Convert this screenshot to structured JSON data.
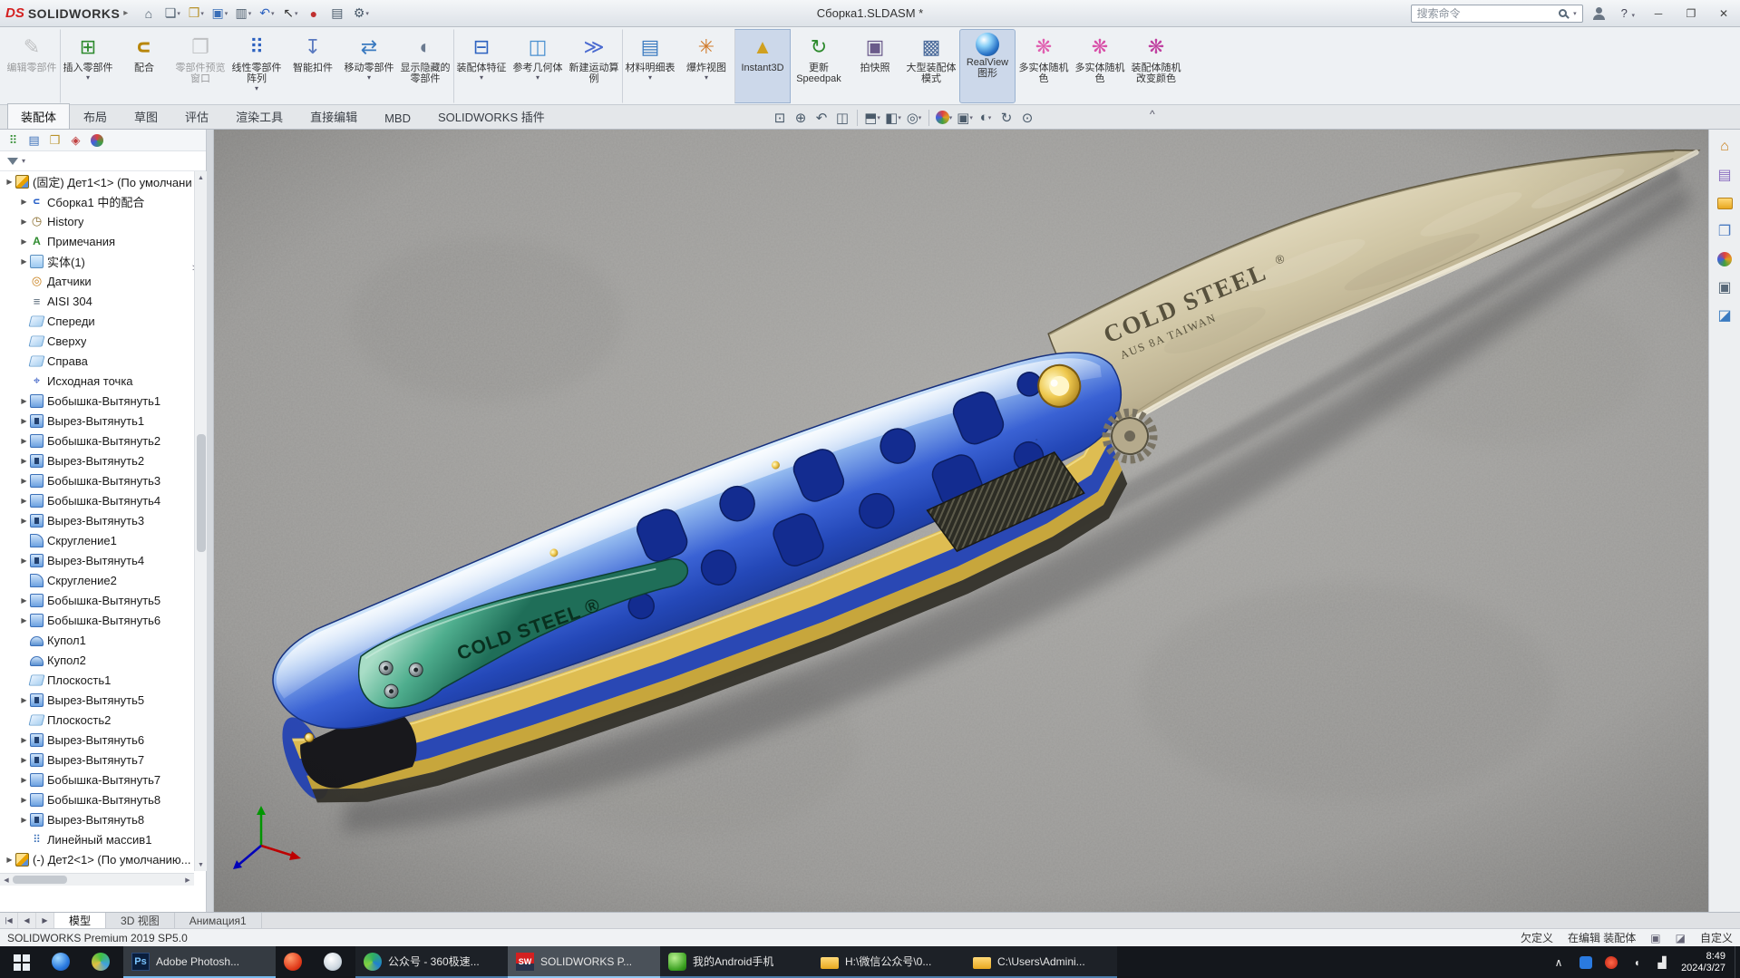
{
  "colors": {
    "accent_blue": "#2a52c8",
    "handle_blue": "#3a62d4",
    "layer_gold": "#debd52",
    "clip_green": "#3f9a7c",
    "blade_tan": "#cfc5a4",
    "ground_gray": "#9a9a97",
    "taskbar_dark": "#14171c",
    "pressed_bg": "#ccd8ea"
  },
  "title_bar": {
    "logo_mark": "DS",
    "logo_text": "SOLIDWORKS",
    "logo_arrow": "▸",
    "title": "Сборка1.SLDASM *",
    "search_placeholder": "搜索命令",
    "help_label": "?",
    "help_dd": "▾",
    "quick_access": [
      {
        "name": "home-icon",
        "glyph": "⌂",
        "dd": "",
        "style": "color:#4a5a6a"
      },
      {
        "name": "new-document-icon",
        "glyph": "❏",
        "dd": "▾",
        "style": "color:#4a5a6a"
      },
      {
        "name": "open-folder-icon",
        "glyph": "❒",
        "dd": "▾",
        "style": "color:#b8922a"
      },
      {
        "name": "save-icon",
        "glyph": "▣",
        "dd": "▾",
        "style": "color:#3a6fb8"
      },
      {
        "name": "print-icon",
        "glyph": "▥",
        "dd": "▾",
        "style": "color:#4a5a6a"
      },
      {
        "name": "undo-icon",
        "glyph": "↶",
        "dd": "▾",
        "style": "color:#2d62c0"
      },
      {
        "name": "select-arrow-icon",
        "glyph": "↖",
        "dd": "▾",
        "style": "color:#333"
      },
      {
        "name": "rebuild-icon",
        "glyph": "●",
        "dd": "",
        "style": "color:#c03030"
      },
      {
        "name": "file-properties-icon",
        "glyph": "▤",
        "dd": "",
        "style": "color:#4a5a6a"
      },
      {
        "name": "options-gear-icon",
        "glyph": "⚙",
        "dd": "▾",
        "style": "color:#4a5a6a"
      }
    ],
    "window_controls": [
      {
        "name": "minimize-button",
        "glyph": "─"
      },
      {
        "name": "maximize-button",
        "glyph": "❐"
      },
      {
        "name": "close-button",
        "glyph": "✕"
      }
    ]
  },
  "ribbon": {
    "buttons": [
      {
        "label": "编辑零部件",
        "glyph": "✎",
        "dd": "",
        "cls": "disabled",
        "icon_style": "color:#7a8a9a"
      },
      {
        "label": "插入零部件",
        "glyph": "⊞",
        "dd": "▾",
        "cls": "sep",
        "icon_style": "color:#2d8a2d"
      },
      {
        "label": "配合",
        "glyph": "∪",
        "dd": "",
        "cls": "",
        "icon_style": "color:#b8860b;transform:rotate(90deg);font-weight:bold"
      },
      {
        "label": "零部件预览窗口",
        "glyph": "❐",
        "dd": "",
        "cls": "disabled",
        "icon_style": "color:#7a8a9a"
      },
      {
        "label": "线性零部件阵列",
        "glyph": "⠿",
        "dd": "▾",
        "cls": "",
        "icon_style": "color:#2d62c0"
      },
      {
        "label": "智能扣件",
        "glyph": "↧",
        "dd": "",
        "cls": "",
        "icon_style": "color:#5a7ac0"
      },
      {
        "label": "移动零部件",
        "glyph": "⇄",
        "dd": "▾",
        "cls": "",
        "icon_style": "color:#3a7ac0"
      },
      {
        "label": "显示隐藏的零部件",
        "glyph": "◐",
        "dd": "",
        "cls": "",
        "icon_style": "color:#6a7a90"
      },
      {
        "label": "装配体特征",
        "glyph": "⊟",
        "dd": "▾",
        "cls": "sep",
        "icon_style": "color:#2d62c0"
      },
      {
        "label": "参考几何体",
        "glyph": "◫",
        "dd": "▾",
        "cls": "",
        "icon_style": "color:#4a90d0"
      },
      {
        "label": "新建运动算例",
        "glyph": "≫",
        "dd": "",
        "cls": "",
        "icon_style": "color:#4a6ad0"
      },
      {
        "label": "材料明细表",
        "glyph": "▤",
        "dd": "▾",
        "cls": "sep",
        "icon_style": "color:#3a7ac0"
      },
      {
        "label": "爆炸视图",
        "glyph": "✳",
        "dd": "▾",
        "cls": "",
        "icon_style": "color:#d07a2a"
      },
      {
        "label": "Instant3D",
        "glyph": "▲",
        "dd": "",
        "cls": "pressed sep",
        "icon_style": "color:#d0a020"
      },
      {
        "label": "更新 Speedpak",
        "glyph": "↻",
        "dd": "",
        "cls": "",
        "icon_style": "color:#2d8a2d"
      },
      {
        "label": "拍快照",
        "glyph": "▣",
        "dd": "",
        "cls": "",
        "icon_style": "color:#6a5a8a"
      },
      {
        "label": "大型装配体模式",
        "glyph": "▩",
        "dd": "",
        "cls": "",
        "icon_style": "color:#4a6a9a"
      },
      {
        "label": "RealView图形",
        "glyph": "",
        "dd": "",
        "cls": "pressed",
        "icon_style": "width:26px;height:26px;border-radius:50%;background:radial-gradient(circle at 35% 30%,#ffffff,#8ad0f8 30%,#2a74c8 65%,#143a70)"
      },
      {
        "label": "多实体随机色",
        "glyph": "❋",
        "dd": "",
        "cls": "",
        "icon_style": "color:#e060b0"
      },
      {
        "label": "多实体随机色",
        "glyph": "❋",
        "dd": "",
        "cls": "",
        "icon_style": "color:#d850a8"
      },
      {
        "label": "装配体随机改变颜色",
        "glyph": "❋",
        "dd": "",
        "cls": "",
        "icon_style": "color:#c040a0"
      }
    ]
  },
  "ribbon_tabs": {
    "items": [
      {
        "label": "装配体",
        "cls": "active"
      },
      {
        "label": "布局",
        "cls": ""
      },
      {
        "label": "草图",
        "cls": ""
      },
      {
        "label": "评估",
        "cls": ""
      },
      {
        "label": "渲染工具",
        "cls": ""
      },
      {
        "label": "直接编辑",
        "cls": ""
      },
      {
        "label": "MBD",
        "cls": ""
      },
      {
        "label": "SOLIDWORKS 插件",
        "cls": ""
      }
    ]
  },
  "headsup": {
    "collapse": "^",
    "items": [
      {
        "name": "zoom-fit-icon",
        "glyph": "⊡",
        "dd": "",
        "cls": "hu",
        "style": ""
      },
      {
        "name": "zoom-area-icon",
        "glyph": "⊕",
        "dd": "",
        "cls": "hu",
        "style": ""
      },
      {
        "name": "previous-view-icon",
        "glyph": "↶",
        "dd": "",
        "cls": "hu",
        "style": ""
      },
      {
        "name": "section-view-icon",
        "glyph": "◫",
        "dd": "",
        "cls": "hu",
        "style": ""
      },
      {
        "name": "separator",
        "glyph": "",
        "dd": "",
        "cls": "husep",
        "style": ""
      },
      {
        "name": "view-orientation-icon",
        "glyph": "⬒",
        "dd": "▾",
        "cls": "hu",
        "style": ""
      },
      {
        "name": "display-style-icon",
        "glyph": "◧",
        "dd": "▾",
        "cls": "hu",
        "style": ""
      },
      {
        "name": "hide-show-items-icon",
        "glyph": "◎",
        "dd": "▾",
        "cls": "hu",
        "style": ""
      },
      {
        "name": "separator",
        "glyph": "",
        "dd": "",
        "cls": "husep",
        "style": ""
      },
      {
        "name": "edit-appearance-icon",
        "glyph": "",
        "dd": "▾",
        "cls": "hu",
        "style": "background:conic-gradient(#e04040,#e0a020,#40a040,#4060e0,#e04040);border-radius:50%;width:15px;height:15px"
      },
      {
        "name": "apply-scene-icon",
        "glyph": "▣",
        "dd": "▾",
        "cls": "hu",
        "style": ""
      },
      {
        "name": "view-settings-icon",
        "glyph": "◐",
        "dd": "▾",
        "cls": "hu",
        "style": ""
      },
      {
        "name": "rotate-view-icon",
        "glyph": "↻",
        "dd": "",
        "cls": "hu",
        "style": ""
      },
      {
        "name": "magnify-icon",
        "glyph": "⊙",
        "dd": "",
        "cls": "hu",
        "style": ""
      }
    ]
  },
  "panel": {
    "tabs": [
      {
        "name": "feature-manager-tree-icon",
        "glyph": "⠿",
        "style": "color:#2d8a2d"
      },
      {
        "name": "property-manager-icon",
        "glyph": "▤",
        "style": "color:#3a6fb8"
      },
      {
        "name": "configuration-manager-icon",
        "glyph": "❒",
        "style": "color:#b8922a"
      },
      {
        "name": "dimxpert-manager-icon",
        "glyph": "◈",
        "style": "color:#c04040"
      },
      {
        "name": "display-manager-icon",
        "glyph": "",
        "style": "background:conic-gradient(#e04040,#40a040,#4060e0,#e04040);border-radius:50%;width:14px;height:14px"
      }
    ],
    "expand": ">",
    "filter_dd": "▾"
  },
  "feature_tree": {
    "items": [
      {
        "label": "(固定) Дет1<1> (По умолчани",
        "icon": "ti-part",
        "name": "part-icon",
        "arrow": "▶",
        "cls": "lvl0"
      },
      {
        "label": "Сборка1 中的配合",
        "icon": "ti-mate",
        "name": "mates-folder-icon",
        "arrow": "▶",
        "cls": "lvl1"
      },
      {
        "label": "History",
        "icon": "ti-hist",
        "name": "history-folder-icon",
        "arrow": "▶",
        "cls": "lvl1"
      },
      {
        "label": "Примечания",
        "icon": "ti-annot",
        "name": "annotations-icon",
        "arrow": "▶",
        "cls": "lvl1"
      },
      {
        "label": "实体(1)",
        "icon": "ti-bodies",
        "name": "solid-bodies-folder-icon",
        "arrow": "▶",
        "cls": "lvl1"
      },
      {
        "label": "Датчики",
        "icon": "ti-sensor",
        "name": "sensors-icon",
        "arrow": "",
        "cls": "lvl1"
      },
      {
        "label": "AISI 304",
        "icon": "ti-material",
        "name": "material-icon",
        "arrow": "",
        "cls": "lvl1"
      },
      {
        "label": "Спереди",
        "icon": "ti-plane",
        "name": "front-plane-icon",
        "arrow": "",
        "cls": "lvl1"
      },
      {
        "label": "Сверху",
        "icon": "ti-plane",
        "name": "top-plane-icon",
        "arrow": "",
        "cls": "lvl1"
      },
      {
        "label": "Справа",
        "icon": "ti-plane",
        "name": "right-plane-icon",
        "arrow": "",
        "cls": "lvl1"
      },
      {
        "label": "Исходная точка",
        "icon": "ti-origin",
        "name": "origin-icon",
        "arrow": "",
        "cls": "lvl1"
      },
      {
        "label": "Бобышка-Вытянуть1",
        "icon": "ti-boss",
        "name": "boss-extrude-icon",
        "arrow": "▶",
        "cls": "lvl1"
      },
      {
        "label": "Вырез-Вытянуть1",
        "icon": "ti-cut",
        "name": "cut-extrude-icon",
        "arrow": "▶",
        "cls": "lvl1"
      },
      {
        "label": "Бобышка-Вытянуть2",
        "icon": "ti-boss",
        "name": "boss-extrude-icon",
        "arrow": "▶",
        "cls": "lvl1"
      },
      {
        "label": "Вырез-Вытянуть2",
        "icon": "ti-cut",
        "name": "cut-extrude-icon",
        "arrow": "▶",
        "cls": "lvl1"
      },
      {
        "label": "Бобышка-Вытянуть3",
        "icon": "ti-boss",
        "name": "boss-extrude-icon",
        "arrow": "▶",
        "cls": "lvl1"
      },
      {
        "label": "Бобышка-Вытянуть4",
        "icon": "ti-boss",
        "name": "boss-extrude-icon",
        "arrow": "▶",
        "cls": "lvl1"
      },
      {
        "label": "Вырез-Вытянуть3",
        "icon": "ti-cut",
        "name": "cut-extrude-icon",
        "arrow": "▶",
        "cls": "lvl1"
      },
      {
        "label": "Скругление1",
        "icon": "ti-fillet",
        "name": "fillet-icon",
        "arrow": "",
        "cls": "lvl1"
      },
      {
        "label": "Вырез-Вытянуть4",
        "icon": "ti-cut",
        "name": "cut-extrude-icon",
        "arrow": "▶",
        "cls": "lvl1"
      },
      {
        "label": "Скругление2",
        "icon": "ti-fillet",
        "name": "fillet-icon",
        "arrow": "",
        "cls": "lvl1"
      },
      {
        "label": "Бобышка-Вытянуть5",
        "icon": "ti-boss",
        "name": "boss-extrude-icon",
        "arrow": "▶",
        "cls": "lvl1"
      },
      {
        "label": "Бобышка-Вытянуть6",
        "icon": "ti-boss",
        "name": "boss-extrude-icon",
        "arrow": "▶",
        "cls": "lvl1"
      },
      {
        "label": "Купол1",
        "icon": "ti-dome",
        "name": "dome-icon",
        "arrow": "",
        "cls": "lvl1"
      },
      {
        "label": "Купол2",
        "icon": "ti-dome",
        "name": "dome-icon",
        "arrow": "",
        "cls": "lvl1"
      },
      {
        "label": "Плоскость1",
        "icon": "ti-plane",
        "name": "reference-plane-icon",
        "arrow": "",
        "cls": "lvl1"
      },
      {
        "label": "Вырез-Вытянуть5",
        "icon": "ti-cut",
        "name": "cut-extrude-icon",
        "arrow": "▶",
        "cls": "lvl1"
      },
      {
        "label": "Плоскость2",
        "icon": "ti-plane",
        "name": "reference-plane-icon",
        "arrow": "",
        "cls": "lvl1"
      },
      {
        "label": "Вырез-Вытянуть6",
        "icon": "ti-cut",
        "name": "cut-extrude-icon",
        "arrow": "▶",
        "cls": "lvl1"
      },
      {
        "label": "Вырез-Вытянуть7",
        "icon": "ti-cut",
        "name": "cut-extrude-icon",
        "arrow": "▶",
        "cls": "lvl1"
      },
      {
        "label": "Бобышка-Вытянуть7",
        "icon": "ti-boss",
        "name": "boss-extrude-icon",
        "arrow": "▶",
        "cls": "lvl1"
      },
      {
        "label": "Бобышка-Вытянуть8",
        "icon": "ti-boss",
        "name": "boss-extrude-icon",
        "arrow": "▶",
        "cls": "lvl1"
      },
      {
        "label": "Вырез-Вытянуть8",
        "icon": "ti-cut",
        "name": "cut-extrude-icon",
        "arrow": "▶",
        "cls": "lvl1"
      },
      {
        "label": "Линейный массив1",
        "icon": "ti-pattern",
        "name": "linear-pattern-icon",
        "arrow": "",
        "cls": "lvl1"
      },
      {
        "label": "(-) Дет2<1> (По умолчанию...",
        "icon": "ti-part",
        "name": "part-icon",
        "arrow": "▶",
        "cls": "lvl0"
      }
    ]
  },
  "viewport": {
    "blade_text": "COLD STEEL",
    "blade_reg": "®",
    "blade_text2": "AUS 8A TAIWAN",
    "clip_text": "COLD STEEL ®"
  },
  "task_pane": {
    "items": [
      {
        "name": "solidworks-resources-icon",
        "glyph": "⌂",
        "style": "color:#c87f1a"
      },
      {
        "name": "design-library-icon",
        "glyph": "▤",
        "style": "color:#8a6dc0"
      },
      {
        "name": "file-explorer-icon",
        "glyph": "",
        "style": "background:linear-gradient(#ffd978,#e8a820);border:1px solid #b8821a;width:17px;height:13px;border-radius:2px"
      },
      {
        "name": "view-palette-icon",
        "glyph": "❐",
        "style": "color:#4a7ac0"
      },
      {
        "name": "appearances-icon",
        "glyph": "",
        "style": "background:conic-gradient(#e04040,#e0a020,#40a040,#4060e0,#e04040);border-radius:50%;width:16px;height:16px"
      },
      {
        "name": "custom-properties-icon",
        "glyph": "▣",
        "style": "color:#5a6a7a"
      },
      {
        "name": "forum-icon",
        "glyph": "◪",
        "style": "color:#3a7ac0"
      }
    ]
  },
  "bottom_tabs": {
    "nav": [
      {
        "glyph": "|◀"
      },
      {
        "glyph": "◀"
      },
      {
        "glyph": "▶"
      }
    ],
    "items": [
      {
        "label": "模型",
        "cls": "active"
      },
      {
        "label": "3D 视图",
        "cls": ""
      },
      {
        "label": "Анимация1",
        "cls": ""
      }
    ]
  },
  "status_bar": {
    "left": "SOLIDWORKS Premium 2019 SP5.0",
    "items": [
      {
        "t": "欠定义"
      },
      {
        "t": "在编辑 装配体"
      },
      {
        "t": "自定义"
      }
    ]
  },
  "taskbar": {
    "buttons": [
      {
        "label": "",
        "icon_glyph": "",
        "cls": "icononly",
        "icon_style": "background:radial-gradient(circle at 35% 30%,#9fd8ff,#2a7ae0 60%,#1a4a9a);border-radius:50%",
        "name": "browser-icon"
      },
      {
        "label": "",
        "icon_glyph": "",
        "cls": "icononly",
        "icon_style": "background:conic-gradient(#40c040,#40a0e0,#e0c040,#40c040);border-radius:50%",
        "name": "360-speed-icon"
      },
      {
        "label": "Adobe Photosh...",
        "icon_glyph": "Ps",
        "cls": "win hl",
        "icon_style": "background:#0a1e3c;color:#7ac4ff;font-weight:bold;font-size:11px;border:1px solid #2a4a7a",
        "name": "photoshop-icon"
      },
      {
        "label": "",
        "icon_glyph": "",
        "cls": "icononly",
        "icon_style": "background:radial-gradient(circle at 35% 30%,#ff9a6a,#e03a1a 65%,#a02010);border-radius:50%",
        "name": "red-app-icon"
      },
      {
        "label": "",
        "icon_glyph": "",
        "cls": "icononly",
        "icon_style": "background:radial-gradient(circle at 40% 35%,#ffffff,#cfd8e0 60%,#9aa8b4);border-radius:50%",
        "name": "white-app-icon"
      },
      {
        "label": "公众号 - 360极速...",
        "icon_glyph": "",
        "cls": "win",
        "icon_style": "background:conic-gradient(#30b060,#2080d0,#80d040,#30b060);border-radius:50%",
        "name": "browser-window-icon"
      },
      {
        "label": "SOLIDWORKS P...",
        "icon_glyph": "SW",
        "cls": "win hl2",
        "icon_style": "background:linear-gradient(#d42020 60%,#28324a 60%);color:#fff;font-weight:bold;font-size:9px",
        "name": "solidworks-icon"
      },
      {
        "label": "我的Android手机",
        "icon_glyph": "",
        "cls": "win",
        "icon_style": "background:radial-gradient(circle at 35% 30%,#b8f090,#3aa020 70%,#207010);border-radius:4px",
        "name": "android-phone-icon"
      },
      {
        "label": "H:\\微信公众号\\0...",
        "icon_glyph": "",
        "cls": "win",
        "icon_style": "background:linear-gradient(#ffd978,#e8a820);border-radius:2px;height:13px;margin-top:3px",
        "name": "folder-icon"
      },
      {
        "label": "C:\\Users\\Admini...",
        "icon_glyph": "",
        "cls": "win",
        "icon_style": "background:linear-gradient(#ffd978,#e8a820);border-radius:2px;height:13px;margin-top:3px",
        "name": "folder-icon"
      }
    ],
    "tray": {
      "chevron": "∧",
      "icons": [
        {
          "name": "tray-blue-icon",
          "glyph": "",
          "style": "background:#2a7ae0;border-radius:3px;width:14px;height:14px"
        },
        {
          "name": "tray-red-icon",
          "glyph": "",
          "style": "background:radial-gradient(circle,#ff6a4a,#c02010);border-radius:50%;width:14px;height:14px"
        },
        {
          "name": "volume-icon",
          "glyph": "◖",
          "style": "color:#e8e8e8"
        },
        {
          "name": "network-icon",
          "glyph": "▟",
          "style": "color:#e8e8e8"
        }
      ],
      "time": "8:49",
      "date": "2024/3/27"
    }
  }
}
